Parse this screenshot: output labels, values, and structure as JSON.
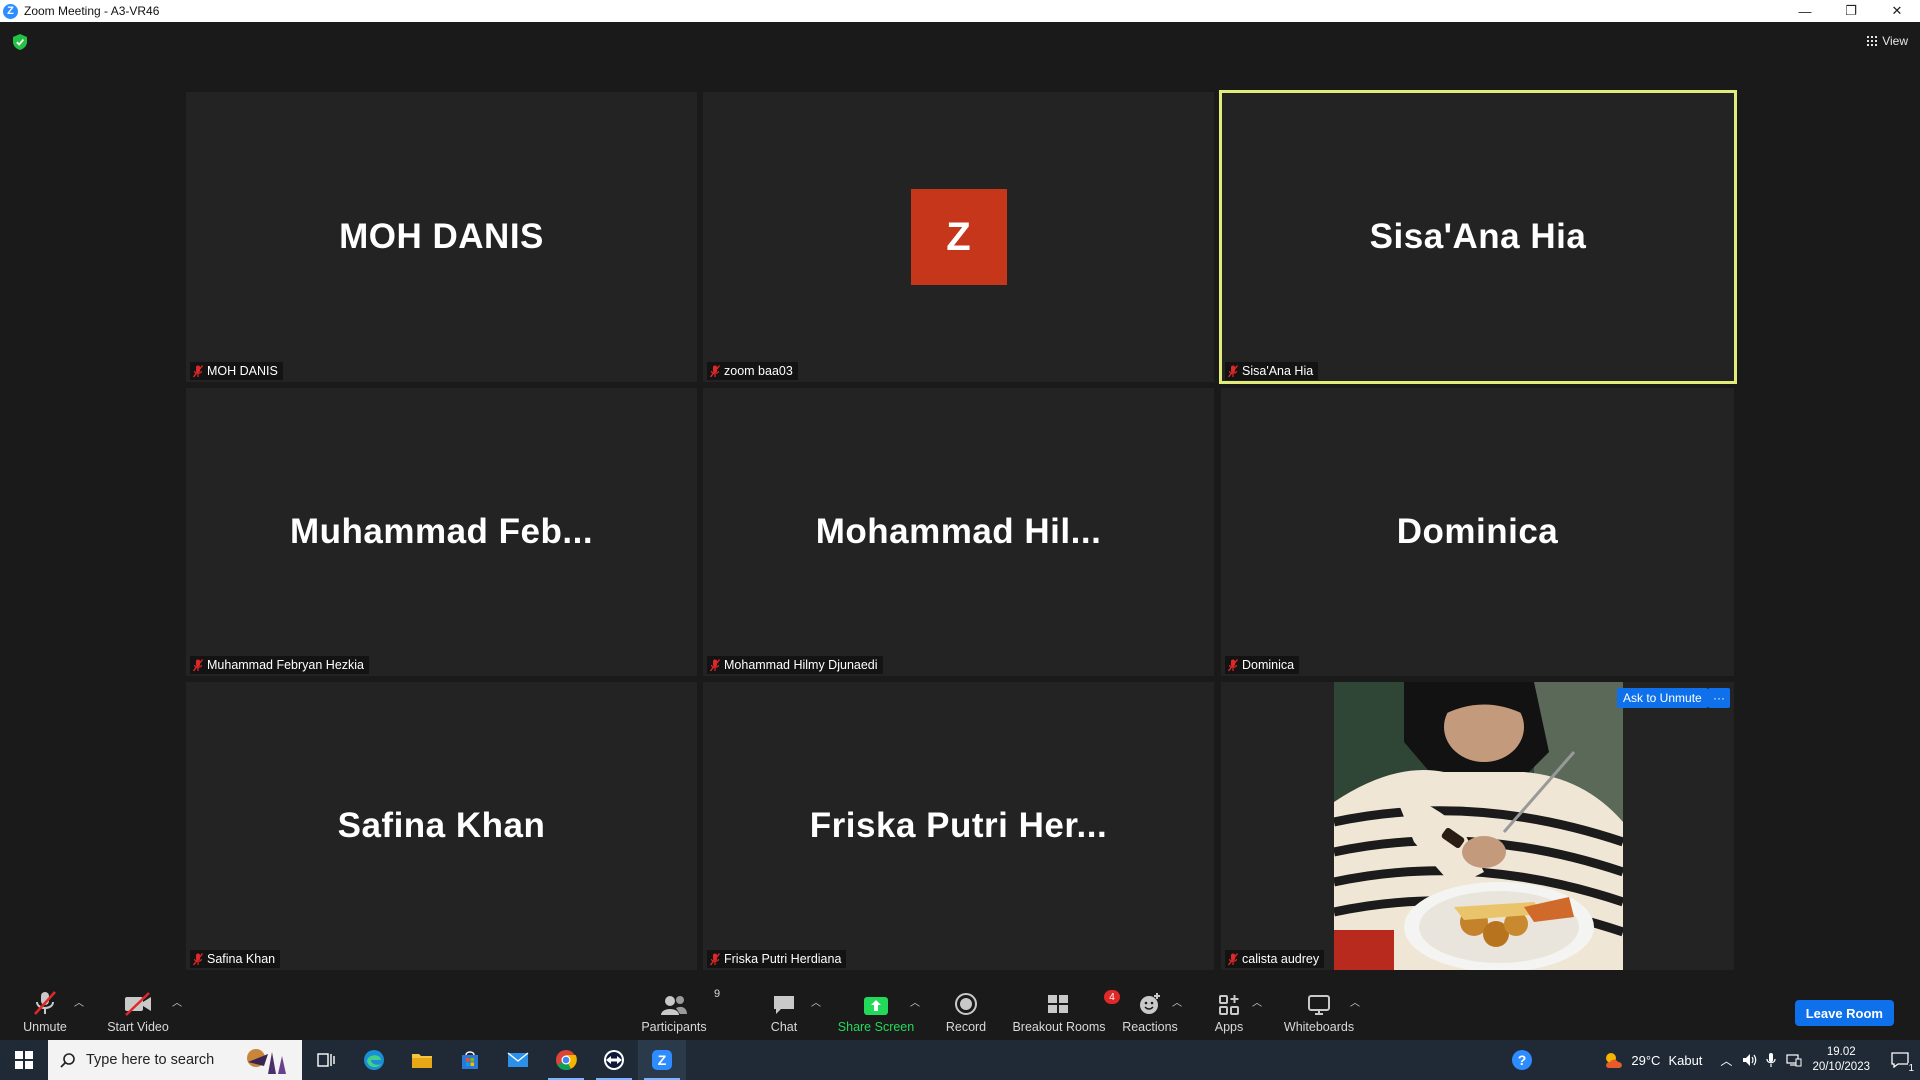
{
  "window": {
    "title": "Zoom Meeting - A3-VR46",
    "logo_letter": "Z",
    "minimize": "—",
    "restore": "❐",
    "close": "✕"
  },
  "meeting": {
    "view_label": "View",
    "security_icon": "shield-check-icon",
    "tiles": [
      {
        "display": "MOH DANIS",
        "name": "MOH DANIS"
      },
      {
        "display": "Z",
        "name": "zoom baa03",
        "avatar_color": "#c6361b"
      },
      {
        "display": "Sisa'Ana Hia",
        "name": "Sisa'Ana Hia",
        "active_speaker": true
      },
      {
        "display": "Muhammad  Feb...",
        "name": "Muhammad Febryan Hezkia"
      },
      {
        "display": "Mohammad  Hil...",
        "name": "Mohammad Hilmy Djunaedi"
      },
      {
        "display": "Dominica",
        "name": "Dominica"
      },
      {
        "display": "Safina Khan",
        "name": "Safina Khan"
      },
      {
        "display": "Friska  Putri  Her...",
        "name": "Friska Putri Herdiana"
      },
      {
        "display": "",
        "name": "calista audrey",
        "has_video": true
      }
    ],
    "ask_to_unmute": "Ask to Unmute",
    "more": "···",
    "speaker_color": "#e1ec7a"
  },
  "toolbar": {
    "unmute": "Unmute",
    "start_video": "Start Video",
    "participants": "Participants",
    "participants_count": "9",
    "chat": "Chat",
    "share_screen": "Share Screen",
    "record": "Record",
    "breakout_rooms": "Breakout Rooms",
    "breakout_badge": "4",
    "reactions": "Reactions",
    "apps": "Apps",
    "whiteboards": "Whiteboards",
    "leave": "Leave Room",
    "share_color": "#23d959",
    "leave_color": "#0e71eb"
  },
  "taskbar": {
    "search_placeholder": "Type here to search",
    "weather_temp": "29°C",
    "weather_desc": "Kabut",
    "time": "19.02",
    "date": "20/10/2023",
    "notification_count": "1"
  }
}
